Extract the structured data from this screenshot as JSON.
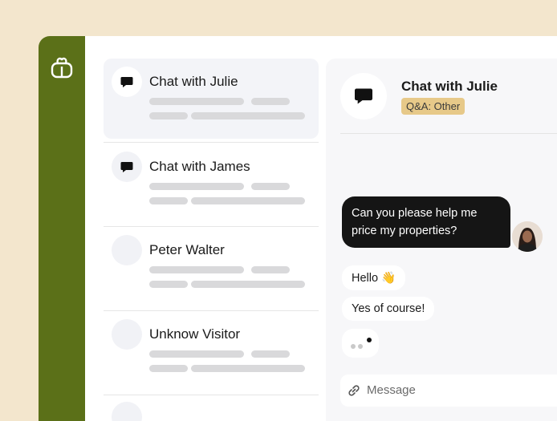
{
  "conversations": [
    {
      "name": "Chat with Julie",
      "icon": "chat-bubble-icon",
      "active": true
    },
    {
      "name": "Chat with James",
      "icon": "chat-bubble-icon",
      "active": false
    },
    {
      "name": "Peter Walter",
      "icon": "",
      "active": false
    },
    {
      "name": "Unknow Visitor",
      "icon": "",
      "active": false
    }
  ],
  "chat": {
    "title": "Chat with Julie",
    "tag": "Q&A: Other",
    "messages": {
      "outgoing": "Can you please help me price my properties?",
      "reply1": "Hello 👋",
      "reply2": "Yes of course!"
    },
    "composer_placeholder": "Message"
  },
  "colors": {
    "background": "#f3e6cd",
    "rail": "#5b7018",
    "tag": "#e7c989",
    "bubble_dark": "#151515"
  }
}
